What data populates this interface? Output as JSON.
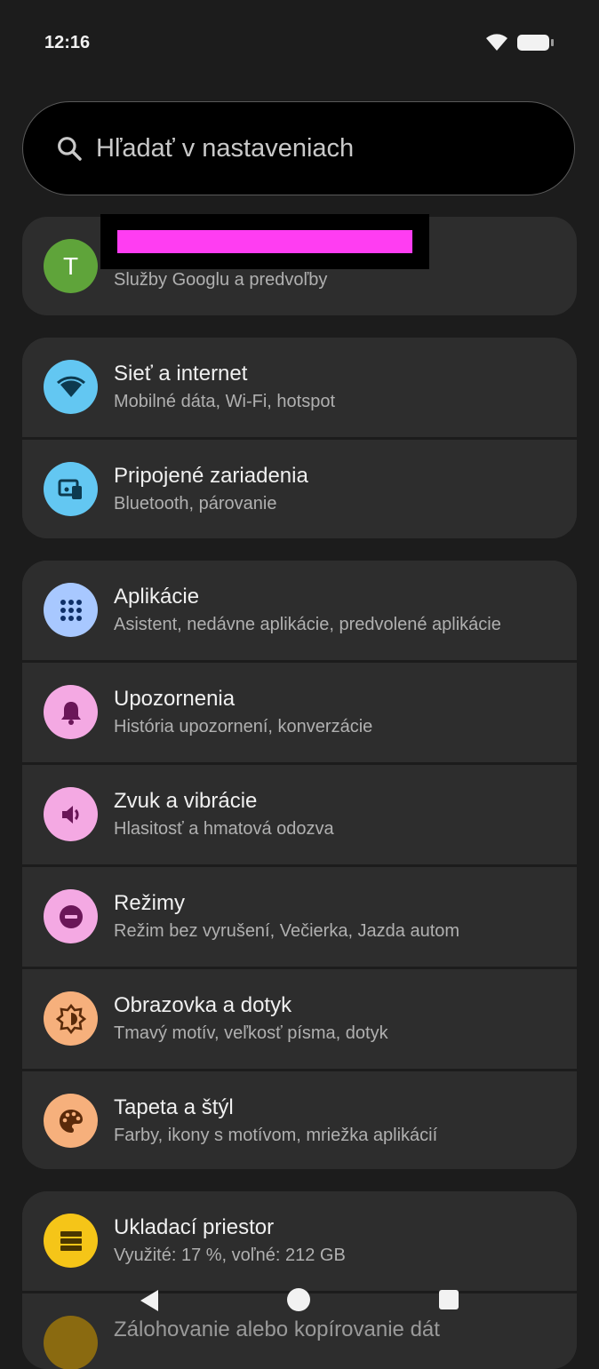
{
  "status_bar": {
    "time": "12:16",
    "wifi_icon": "wifi-icon",
    "battery_icon": "battery-icon"
  },
  "search": {
    "placeholder": "Hľadať v nastaveniach",
    "icon": "search-icon"
  },
  "account": {
    "avatar_letter": "T",
    "avatar_color": "#5fa43a",
    "subtitle": "Služby Googlu a predvoľby",
    "redaction_color": "#ff3df2"
  },
  "groups": [
    {
      "items": [
        {
          "title": "Sieť a internet",
          "subtitle": "Mobilné dáta, Wi-Fi, hotspot",
          "icon": "wifi-icon",
          "icon_bg": "#63c7f2",
          "icon_fg": "#0d3a4f"
        },
        {
          "title": "Pripojené zariadenia",
          "subtitle": "Bluetooth, párovanie",
          "icon": "connected-devices-icon",
          "icon_bg": "#63c7f2",
          "icon_fg": "#0d3a4f"
        }
      ]
    },
    {
      "items": [
        {
          "title": "Aplikácie",
          "subtitle": "Asistent, nedávne aplikácie, predvolené aplikácie",
          "icon": "apps-grid-icon",
          "icon_bg": "#a8c8ff",
          "icon_fg": "#0e2f67"
        },
        {
          "title": "Upozornenia",
          "subtitle": "História upozornení, konverzácie",
          "icon": "bell-icon",
          "icon_bg": "#f4a9e3",
          "icon_fg": "#6a1658"
        },
        {
          "title": "Zvuk a vibrácie",
          "subtitle": "Hlasitosť a hmatová odozva",
          "icon": "volume-icon",
          "icon_bg": "#f4a9e3",
          "icon_fg": "#6a1658"
        },
        {
          "title": "Režimy",
          "subtitle": "Režim bez vyrušení, Večierka, Jazda autom",
          "icon": "do-not-disturb-icon",
          "icon_bg": "#f4a9e3",
          "icon_fg": "#6a1658"
        },
        {
          "title": "Obrazovka a dotyk",
          "subtitle": "Tmavý motív, veľkosť písma, dotyk",
          "icon": "brightness-icon",
          "icon_bg": "#f6b07c",
          "icon_fg": "#5a2a0a"
        },
        {
          "title": "Tapeta a štýl",
          "subtitle": "Farby, ikony s motívom, mriežka aplikácií",
          "icon": "palette-icon",
          "icon_bg": "#f6b07c",
          "icon_fg": "#5a2a0a"
        }
      ]
    },
    {
      "items": [
        {
          "title": "Ukladací priestor",
          "subtitle": "Využité: 17 %, voľné: 212 GB",
          "icon": "storage-icon",
          "icon_bg": "#f5c518",
          "icon_fg": "#4a3600"
        },
        {
          "title": "Zálohovanie alebo kopírovanie dát",
          "subtitle": "",
          "icon": "backup-icon",
          "icon_bg": "#8a6a10",
          "icon_fg": "#4a3600"
        }
      ]
    }
  ],
  "nav_bar": {
    "back_icon": "back-icon",
    "home_icon": "home-icon",
    "recents_icon": "recents-icon"
  }
}
